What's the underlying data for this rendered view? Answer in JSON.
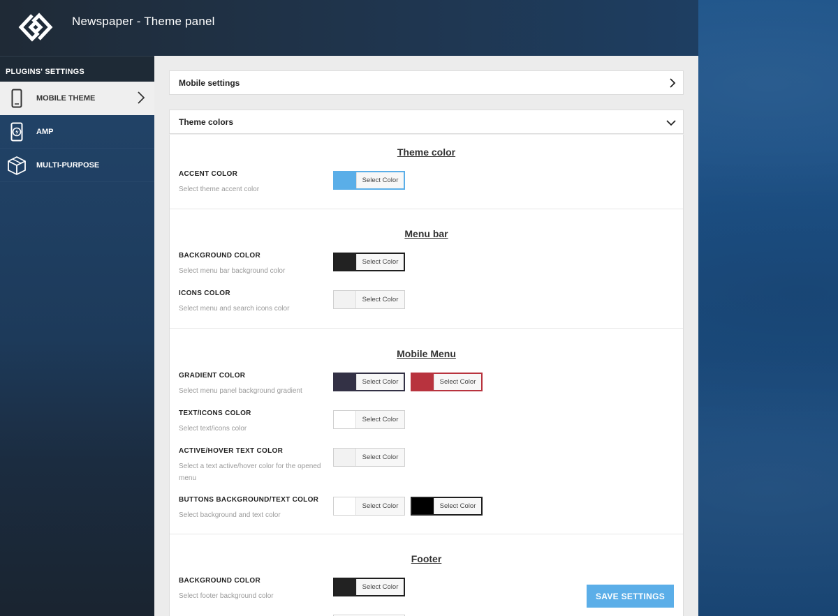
{
  "app": {
    "title": "Newspaper - Theme panel"
  },
  "sidebar": {
    "section_title": "PLUGINS' SETTINGS",
    "items": [
      {
        "label": "MOBILE THEME",
        "icon": "mobile-phone-icon",
        "active": true
      },
      {
        "label": "AMP",
        "icon": "amp-lightning-icon",
        "active": false
      },
      {
        "label": "MULTI-PURPOSE",
        "icon": "box-icon",
        "active": false
      }
    ]
  },
  "main": {
    "accordions": [
      {
        "label": "Mobile settings",
        "state": "collapsed"
      },
      {
        "label": "Theme colors",
        "state": "expanded"
      }
    ],
    "picker_label": "Select Color",
    "sections": {
      "theme_color": {
        "title": "Theme color",
        "options": [
          {
            "label": "ACCENT COLOR",
            "desc": "Select theme accent color",
            "colors": [
              "#5aaee8"
            ]
          }
        ]
      },
      "menu_bar": {
        "title": "Menu bar",
        "options": [
          {
            "label": "BACKGROUND COLOR",
            "desc": "Select menu bar background color",
            "colors": [
              "#222222"
            ]
          },
          {
            "label": "ICONS COLOR",
            "desc": "Select menu and search icons color",
            "colors": [
              "#f2f2f2"
            ]
          }
        ]
      },
      "mobile_menu": {
        "title": "Mobile Menu",
        "options": [
          {
            "label": "GRADIENT COLOR",
            "desc": "Select menu panel background gradient",
            "colors": [
              "#333145",
              "#b8333e"
            ]
          },
          {
            "label": "TEXT/ICONS COLOR",
            "desc": "Select text/icons color",
            "colors": [
              "#ffffff"
            ]
          },
          {
            "label": "ACTIVE/HOVER TEXT COLOR",
            "desc": "Select a text active/hover color for the opened menu",
            "colors": [
              "#f2f2f2"
            ]
          },
          {
            "label": "BUTTONS BACKGROUND/TEXT COLOR",
            "desc": "Select background and text color",
            "colors": [
              "#ffffff",
              "#000000"
            ]
          }
        ]
      },
      "footer": {
        "title": "Footer",
        "options": [
          {
            "label": "BACKGROUND COLOR",
            "desc": "Select footer background color",
            "colors": [
              "#222222"
            ]
          }
        ]
      }
    }
  },
  "actions": {
    "save_label": "SAVE SETTINGS"
  }
}
